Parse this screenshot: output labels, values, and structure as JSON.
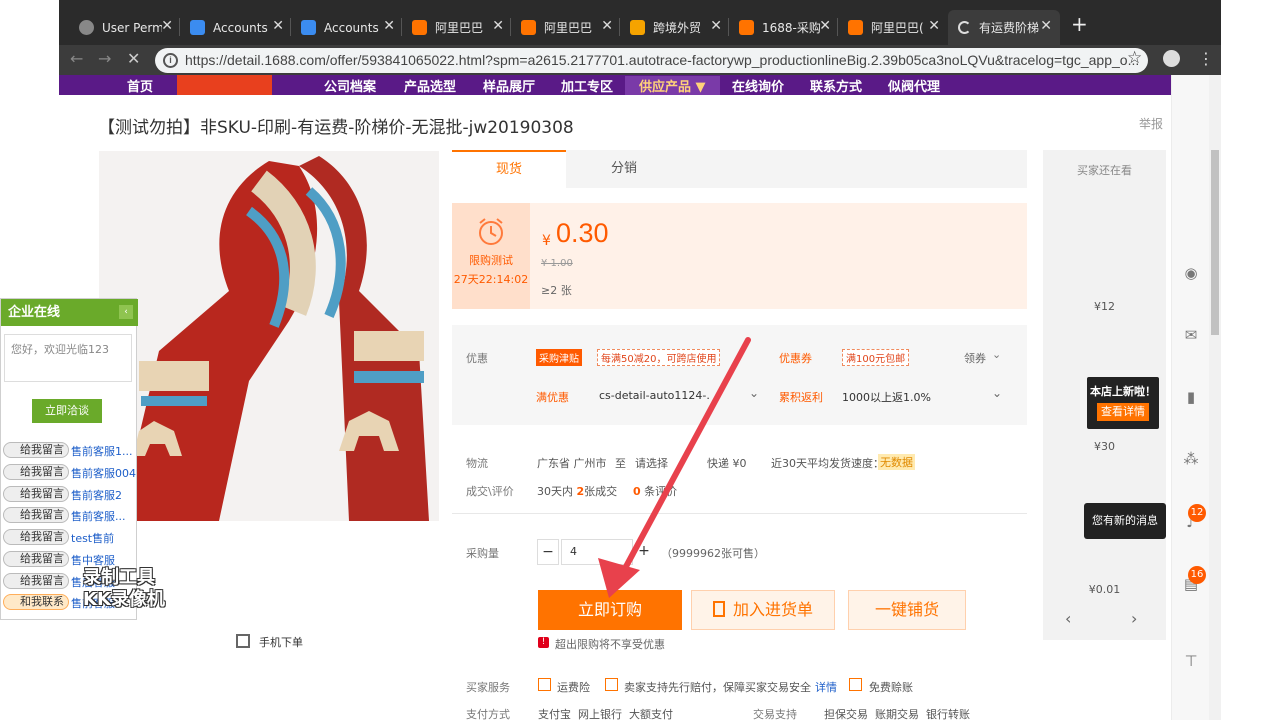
{
  "browser": {
    "tabs": [
      {
        "title": "User Perm",
        "color": "#888888",
        "active": false
      },
      {
        "title": "Accounts",
        "color": "#3b8cf0",
        "active": false
      },
      {
        "title": "Accounts",
        "color": "#3b8cf0",
        "active": false
      },
      {
        "title": "阿里巴巴",
        "color": "#ff7300",
        "active": false
      },
      {
        "title": "阿里巴巴",
        "color": "#ff7300",
        "active": false
      },
      {
        "title": "跨境外贸",
        "color": "#f5a300",
        "active": false
      },
      {
        "title": "1688-采购",
        "color": "#ff7300",
        "active": false
      },
      {
        "title": "阿里巴巴(",
        "color": "#ff7300",
        "active": false
      },
      {
        "title": "有运费阶梯",
        "color": "#dddddd",
        "active": true
      }
    ],
    "url": "https://detail.1688.com/offer/593841065022.html?spm=a2615.2177701.autotrace-factorywp_productionlineBig.2.39b05ca3noLQVu&tracelog=tgc_app_o..."
  },
  "nav": {
    "items": [
      "首页",
      "公司档案",
      "产品选型",
      "样品展厅",
      "加工专区",
      "供应产品 ▼",
      "在线询价",
      "联系方式",
      "似阀代理"
    ]
  },
  "product": {
    "title": "【测试勿拍】非SKU-印刷-有运费-阶梯价-无混批-jw20190308",
    "report": "举报",
    "tab_spot": "现货",
    "tab_dist": "分销",
    "promo_label": "限购测试",
    "promo_timer": "27天22:14:02",
    "currency": "¥",
    "price": "0.30",
    "orig_price": "¥ 1.00",
    "min_qty": "≥2 张",
    "discount_label": "优惠",
    "tag_subsidy": "采购津贴",
    "tag_subsidy_detail": "每满50减20，可跨店使用",
    "coupon_label": "优惠券",
    "coupon_detail": "满100元包邮",
    "get_coupon": "领券",
    "full_label": "满优惠",
    "full_value": "cs-detail-auto1124-.",
    "rebate_label": "累积返利",
    "rebate_value": "1000以上返1.0%",
    "logistics_label": "物流",
    "origin": "广东省 广州市",
    "to": "至",
    "choose": "请选择",
    "express": "快递 ¥0",
    "ship_speed_label": "近30天平均发货速度：",
    "ship_speed": "无数据",
    "deal_label": "成交\\评价",
    "deal_prefix": "30天内",
    "deal_count": "2",
    "deal_suffix": "张成交",
    "review_count": "0",
    "review_suffix": "条评价",
    "qty_label": "采购量",
    "qty_value": "4",
    "stock": "（9999962张可售）",
    "buy_now": "立即订购",
    "add_cart": "加入进货单",
    "one_click": "一键铺货",
    "warn": "超出限购将不享受优惠",
    "service_label": "买家服务",
    "service_freight": "运费险",
    "service_compensate": "卖家支持先行赔付，保障买家交易安全",
    "service_detail": "详情",
    "service_free": "免费赊账",
    "pay_label": "支付方式",
    "pay_methods": "支付宝  网上银行  大额支付",
    "trade_label": "交易支持",
    "trade_methods": "担保交易  账期交易  银行转账",
    "mobile_order": "手机下单"
  },
  "reco": {
    "title": "买家还在看",
    "price1": "¥12",
    "new_badge": "本店上新啦！",
    "view_detail": "查看详情",
    "price2": "¥30",
    "new_msg": "您有新的消息",
    "price3": "¥0.01"
  },
  "toolbar": {
    "badge1": "12",
    "badge2": "16"
  },
  "chat": {
    "title": "企业在线",
    "greeting": "您好，欢迎光临123",
    "start_chat": "立即洽谈",
    "leave_msg": "给我留言",
    "contact_me": "和我联系",
    "agents": [
      "售前客服1...",
      "售前客服004",
      "售前客服2",
      "售前客服...",
      "test售前",
      "售中客服",
      "售后客服",
      "售前客服"
    ]
  },
  "watermark": "录制工具\nKK录像机"
}
